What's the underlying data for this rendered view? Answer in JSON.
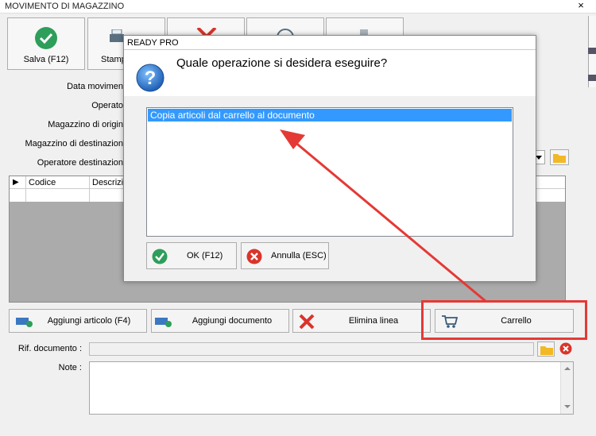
{
  "window": {
    "title": "MOVIMENTO DI MAGAZZINO",
    "close": "×"
  },
  "toolbar": {
    "save_label": "Salva (F12)",
    "print_label": "Stamp"
  },
  "form": {
    "data_movimento": "Data movimen",
    "operatore": "Operato",
    "magazzino_origine": "Magazzino di origin",
    "magazzino_destinazione": "Magazzino di destinazion",
    "operatore_destinazione": "Operatore destinazion"
  },
  "grid": {
    "columns": [
      "Codice",
      "Descrizio"
    ]
  },
  "actions": {
    "add_article": "Aggiungi articolo (F4)",
    "add_document": "Aggiungi documento",
    "delete_line": "Elimina linea",
    "cart": "Carrello"
  },
  "rif_documento": {
    "label": "Rif. documento :",
    "value": ""
  },
  "note": {
    "label": "Note :",
    "value": ""
  },
  "dialog": {
    "title": "READY PRO",
    "question": "Quale operazione si desidera eseguire?",
    "options": [
      "Copia articoli dal carrello al documento"
    ],
    "ok_label": "OK (F12)",
    "cancel_label": "Annulla (ESC)"
  },
  "colors": {
    "highlight": "#3399ff",
    "annotation": "#e53935",
    "ok_green": "#2e9e5b",
    "cancel_red": "#d9342b"
  }
}
